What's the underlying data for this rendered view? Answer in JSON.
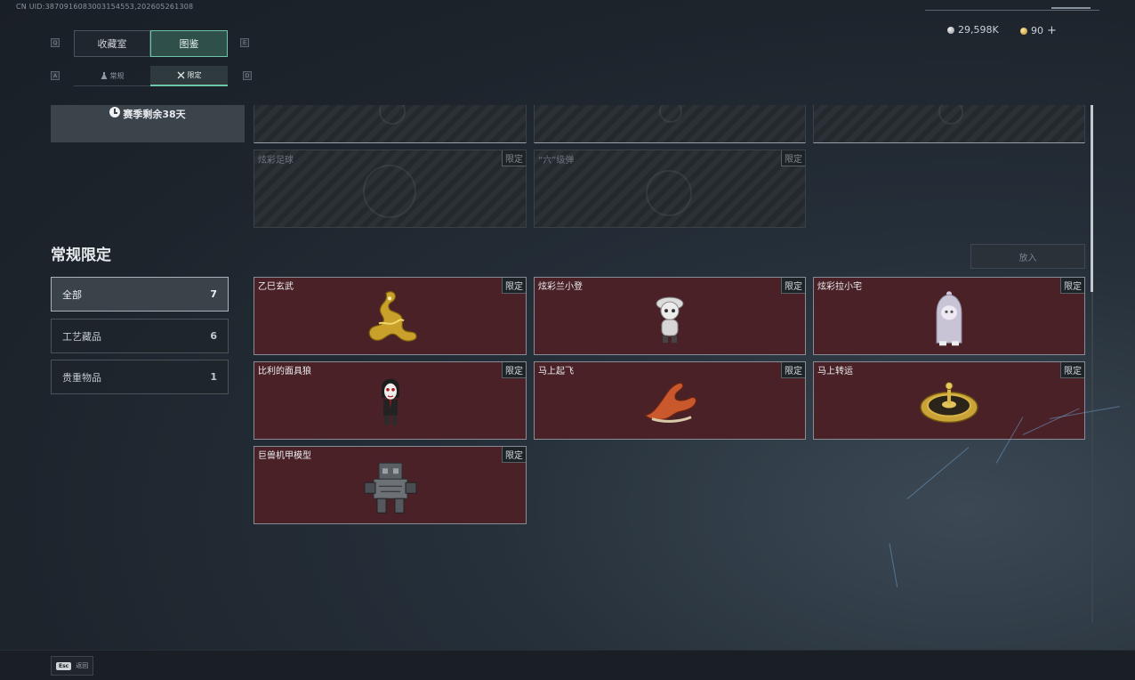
{
  "header": {
    "uid": "CN UID:3870916083003154553,202605261308",
    "currency_1": "29,598K",
    "currency_2": "90",
    "plus": "+"
  },
  "keys": {
    "q": "Q",
    "e": "E",
    "a": "A",
    "d": "D"
  },
  "tabs": [
    {
      "label": "收藏室"
    },
    {
      "label": "图鉴"
    }
  ],
  "subtabs": [
    {
      "label": "常规"
    },
    {
      "label": "限定"
    }
  ],
  "season": {
    "label": "赛季剩余38天"
  },
  "locked_items": [
    {
      "name": "炫彩足球",
      "tag": "限定"
    },
    {
      "name": "“六”级弹",
      "tag": "限定"
    }
  ],
  "section_title": "常规限定",
  "categories": [
    {
      "label": "全部",
      "count": "7"
    },
    {
      "label": "工艺藏品",
      "count": "6"
    },
    {
      "label": "贵重物品",
      "count": "1"
    }
  ],
  "filter_button": "放入",
  "items": [
    {
      "name": "乙巳玄武",
      "tag": "限定",
      "icon": "golden-dragon-icon"
    },
    {
      "name": "炫彩兰小登",
      "tag": "限定",
      "icon": "figurine-icon"
    },
    {
      "name": "炫彩拉小宅",
      "tag": "限定",
      "icon": "hooded-figurine-icon"
    },
    {
      "name": "比利的面具狼",
      "tag": "限定",
      "icon": "puppet-icon"
    },
    {
      "name": "马上起飞",
      "tag": "限定",
      "icon": "flying-horse-icon"
    },
    {
      "name": "马上转运",
      "tag": "限定",
      "icon": "golden-disc-icon"
    },
    {
      "name": "巨兽机甲模型",
      "tag": "限定",
      "icon": "mecha-model-icon"
    }
  ],
  "footer": {
    "esc_key": "Esc",
    "esc_label": "返回"
  },
  "colors": {
    "accent": "#6fc5a8",
    "card_bg": "#4a2127",
    "background": "#1d242c"
  }
}
